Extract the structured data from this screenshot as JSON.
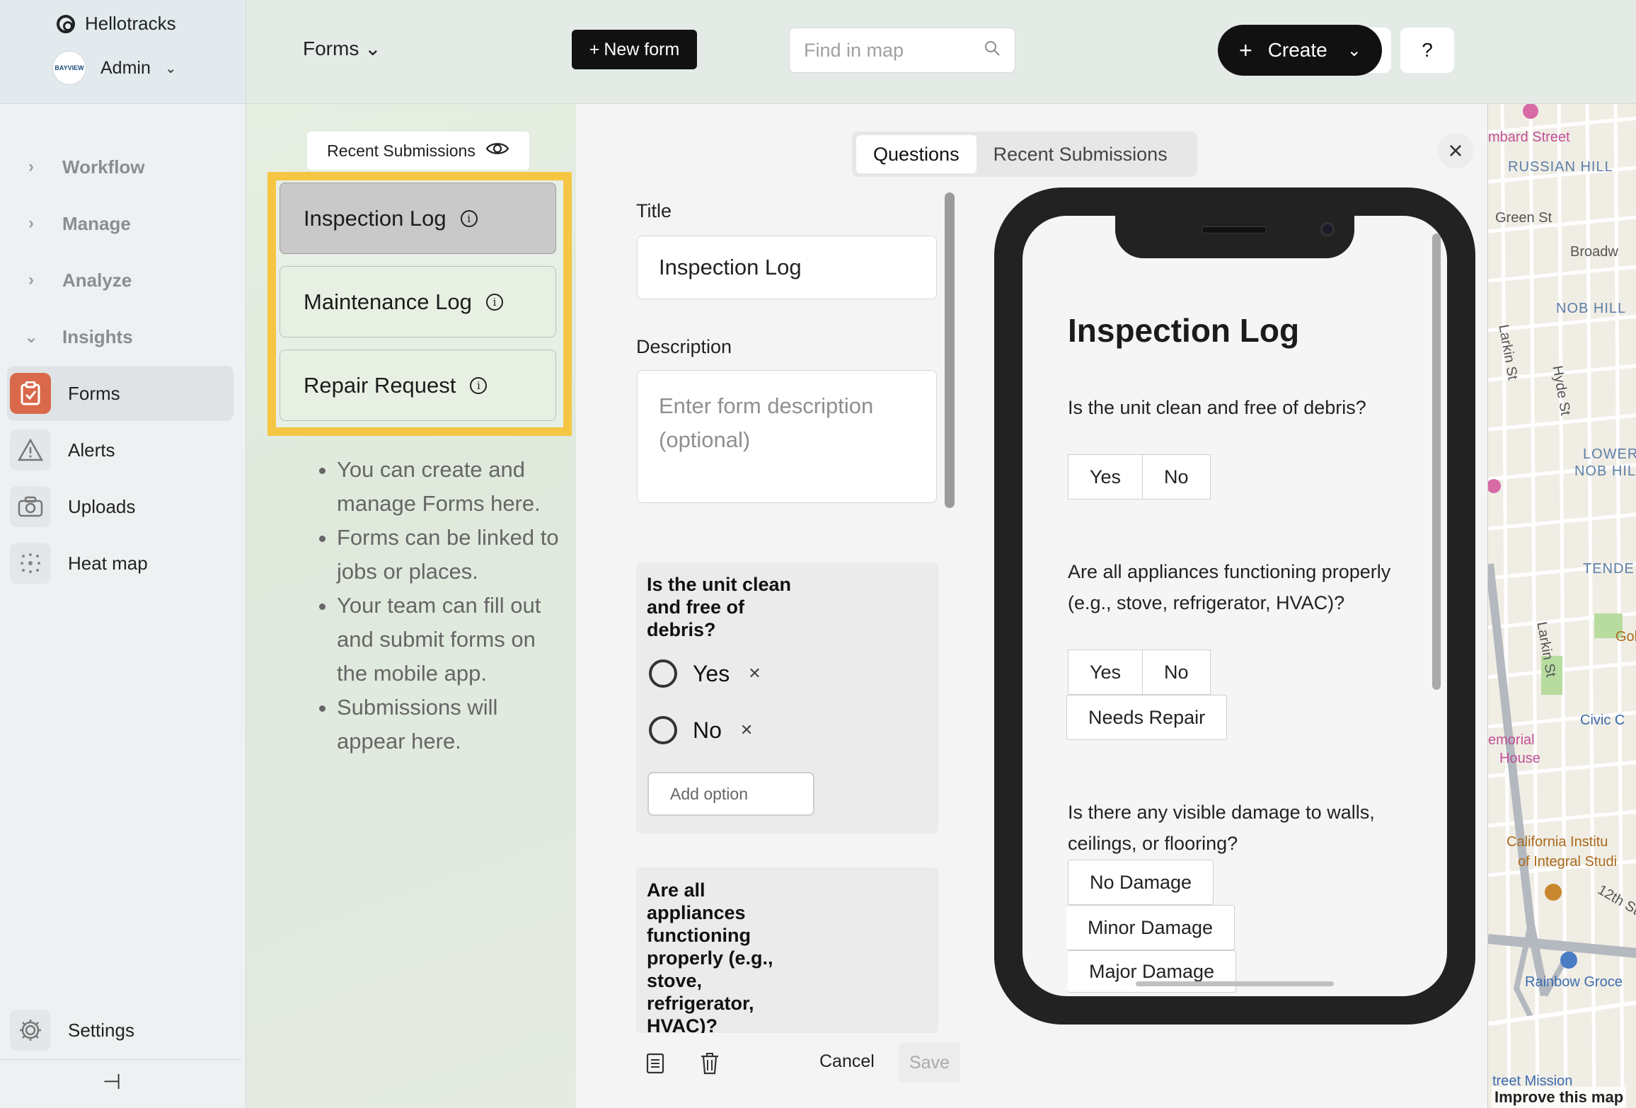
{
  "sidebar": {
    "brand": "Hellotracks",
    "account_logo": "BAYVIEW",
    "account": "Admin",
    "groups": [
      {
        "label": "Workflow",
        "expanded": false
      },
      {
        "label": "Manage",
        "expanded": false
      },
      {
        "label": "Analyze",
        "expanded": false
      },
      {
        "label": "Insights",
        "expanded": true
      }
    ],
    "items": [
      {
        "label": "Forms",
        "icon": "clipboard-check-icon",
        "active": true
      },
      {
        "label": "Alerts",
        "icon": "warning-icon",
        "active": false
      },
      {
        "label": "Uploads",
        "icon": "camera-icon",
        "active": false
      },
      {
        "label": "Heat map",
        "icon": "dots-grid-icon",
        "active": false
      }
    ],
    "settings": "Settings",
    "chev_right": "›",
    "chev_down": "⌄",
    "pin_glyph": "⊣"
  },
  "header": {
    "forms_dropdown": "Forms",
    "new_form": "New form",
    "search_placeholder": "Find in map",
    "help": "?",
    "create": "Create"
  },
  "forms_list": {
    "recent_submissions": "Recent Submissions",
    "forms": [
      {
        "name": "Inspection Log",
        "selected": true
      },
      {
        "name": "Maintenance Log",
        "selected": false
      },
      {
        "name": "Repair Request",
        "selected": false
      }
    ],
    "tips": [
      "You can create and manage Forms here.",
      "Forms can be linked to jobs or places.",
      "Your team can fill out and submit forms on the mobile app.",
      "Submissions will appear here."
    ],
    "highlight_color": "#f5c643"
  },
  "editor": {
    "tabs": [
      {
        "label": "Questions",
        "active": true
      },
      {
        "label": "Recent Submissions",
        "active": false
      }
    ],
    "title_label": "Title",
    "title_value": "Inspection Log",
    "description_label": "Description",
    "description_placeholder": "Enter form description (optional)",
    "questions": [
      {
        "title": "Is the unit clean and free of debris?",
        "options": [
          "Yes",
          "No"
        ],
        "add_option": "Add option"
      },
      {
        "title": "Are all appliances functioning properly (e.g., stove, refrigerator, HVAC)?"
      }
    ],
    "cancel": "Cancel",
    "save": "Save"
  },
  "preview": {
    "title": "Inspection Log",
    "questions": [
      {
        "text": "Is the unit clean and free of debris?",
        "options": [
          "Yes",
          "No"
        ]
      },
      {
        "text": "Are all appliances functioning properly (e.g., stove, refrigerator, HVAC)?",
        "options": [
          "Yes",
          "No",
          "Needs Repair"
        ]
      },
      {
        "text": "Is there any visible damage to walls, ceilings, or flooring?",
        "options": [
          "No Damage",
          "Minor Damage",
          "Major Damage"
        ]
      }
    ]
  },
  "map": {
    "labels": [
      "mbard Street",
      "RUSSIAN HILL",
      "Green St",
      "Broadw",
      "Larkin St",
      "NOB HILL",
      "Hyde St",
      "LOWER",
      "NOB HIL",
      "TENDE",
      "Larkin St",
      "Gol",
      "Civic C",
      "emorial",
      "House",
      "California Institu",
      "of Integral Studi",
      "12th St",
      "Rainbow Groce",
      "treet Mission"
    ],
    "improve": "Improve this map",
    "accent_green": "#b8dca0",
    "road_gray": "#b4b8bf"
  }
}
